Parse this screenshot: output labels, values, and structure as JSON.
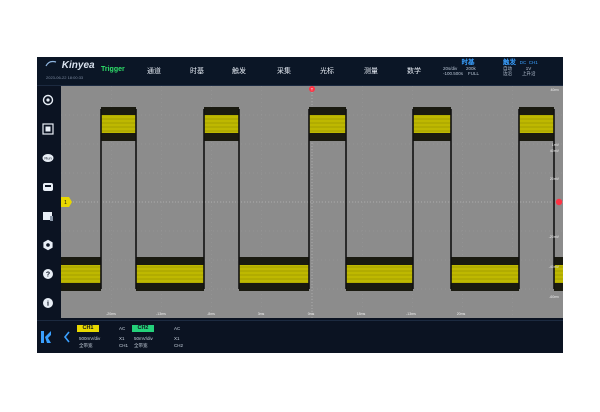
{
  "top": {
    "brand": "Kinyea",
    "datetime": "2023-06-22 18:00:33",
    "trigger_label": "Trigger",
    "menu": [
      "通道",
      "时基",
      "触发",
      "采集",
      "光标",
      "测量",
      "数学"
    ],
    "timebase": {
      "title": "时基",
      "line1a": "20s/div",
      "line1b": "200k",
      "line2a": "-100.500s",
      "line2b": "FULL"
    },
    "trigger_info": {
      "title": "触发",
      "dc": "DC",
      "ch": "CH1",
      "line1a": "自动",
      "line1b": "1V",
      "line2a": "边沿",
      "line2b": "上升沿"
    }
  },
  "sidebar": {
    "icons": [
      "settings-icon",
      "autoset-icon",
      "run-icon",
      "save-icon",
      "display-icon",
      "config-icon",
      "help-icon",
      "info-icon"
    ],
    "run_label": "Run"
  },
  "scope": {
    "channel_marker": "1",
    "trigger_marker": "T",
    "right_labels": [
      "40mv",
      "1mV",
      "40mV",
      "20mV",
      "-20mV",
      "-40mV",
      "-60mv"
    ],
    "bottom_labels": [
      "-20ms",
      "-13ms",
      "-8ms",
      "3ms",
      "0ms",
      "18ms",
      "-13ms",
      "20ms"
    ]
  },
  "bottom": {
    "ch1": {
      "label": "CH1",
      "coupling": "AC",
      "scale": "500mV/div",
      "bandwidth": "全带宽",
      "probe": "X1",
      "name": "CH1",
      "color": "#e8d800"
    },
    "ch2": {
      "label": "CH2",
      "coupling": "AC",
      "scale": "50mV/div",
      "bandwidth": "全带宽",
      "probe": "X1",
      "name": "CH2",
      "color": "#24d17a"
    }
  },
  "colors": {
    "accent": "#3aa0ff",
    "waveform": "#d4d000",
    "trigger": "#ff3344",
    "grid_bg": "#8a8a8a"
  }
}
